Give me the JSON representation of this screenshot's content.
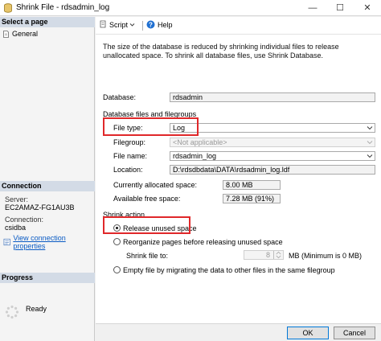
{
  "window": {
    "title": "Shrink File - rdsadmin_log",
    "minimize": "—",
    "maximize": "☐",
    "close": "✕"
  },
  "left": {
    "select_page": "Select a page",
    "nav_general": "General",
    "connection_header": "Connection",
    "server_label": "Server:",
    "server_value": "EC2AMAZ-FG1AU3B",
    "connection_label": "Connection:",
    "connection_value": "csidba",
    "view_conn_link": "View connection properties",
    "progress_header": "Progress",
    "progress_status": "Ready"
  },
  "toolbar": {
    "script_label": "Script",
    "help_label": "Help"
  },
  "description": "The size of the database is reduced by shrinking individual files to release unallocated space. To shrink all database files, use Shrink Database.",
  "form": {
    "database_label": "Database:",
    "database_value": "rdsadmin",
    "files_group_label": "Database files and filegroups",
    "file_type_label": "File type:",
    "file_type_value": "Log",
    "filegroup_label": "Filegroup:",
    "filegroup_value": "<Not applicable>",
    "file_name_label": "File name:",
    "file_name_value": "rdsadmin_log",
    "location_label": "Location:",
    "location_value": "D:\\rdsdbdata\\DATA\\rdsadmin_log.ldf",
    "allocated_label": "Currently allocated space:",
    "allocated_value": "8.00 MB",
    "free_label": "Available free space:",
    "free_value": "7.28 MB (91%)"
  },
  "shrink": {
    "group_label": "Shrink action",
    "option_release": "Release unused space",
    "option_reorganize": "Reorganize pages before releasing unused space",
    "shrink_to_label": "Shrink file to:",
    "shrink_to_value": "8",
    "shrink_to_unit": "MB (Minimum is 0 MB)",
    "option_empty": "Empty file by migrating the data to other files in the same filegroup"
  },
  "buttons": {
    "ok": "OK",
    "cancel": "Cancel"
  },
  "colors": {
    "highlight": "#e0282a",
    "section_header": "#d3dbe6",
    "link": "#0a5bc4"
  }
}
